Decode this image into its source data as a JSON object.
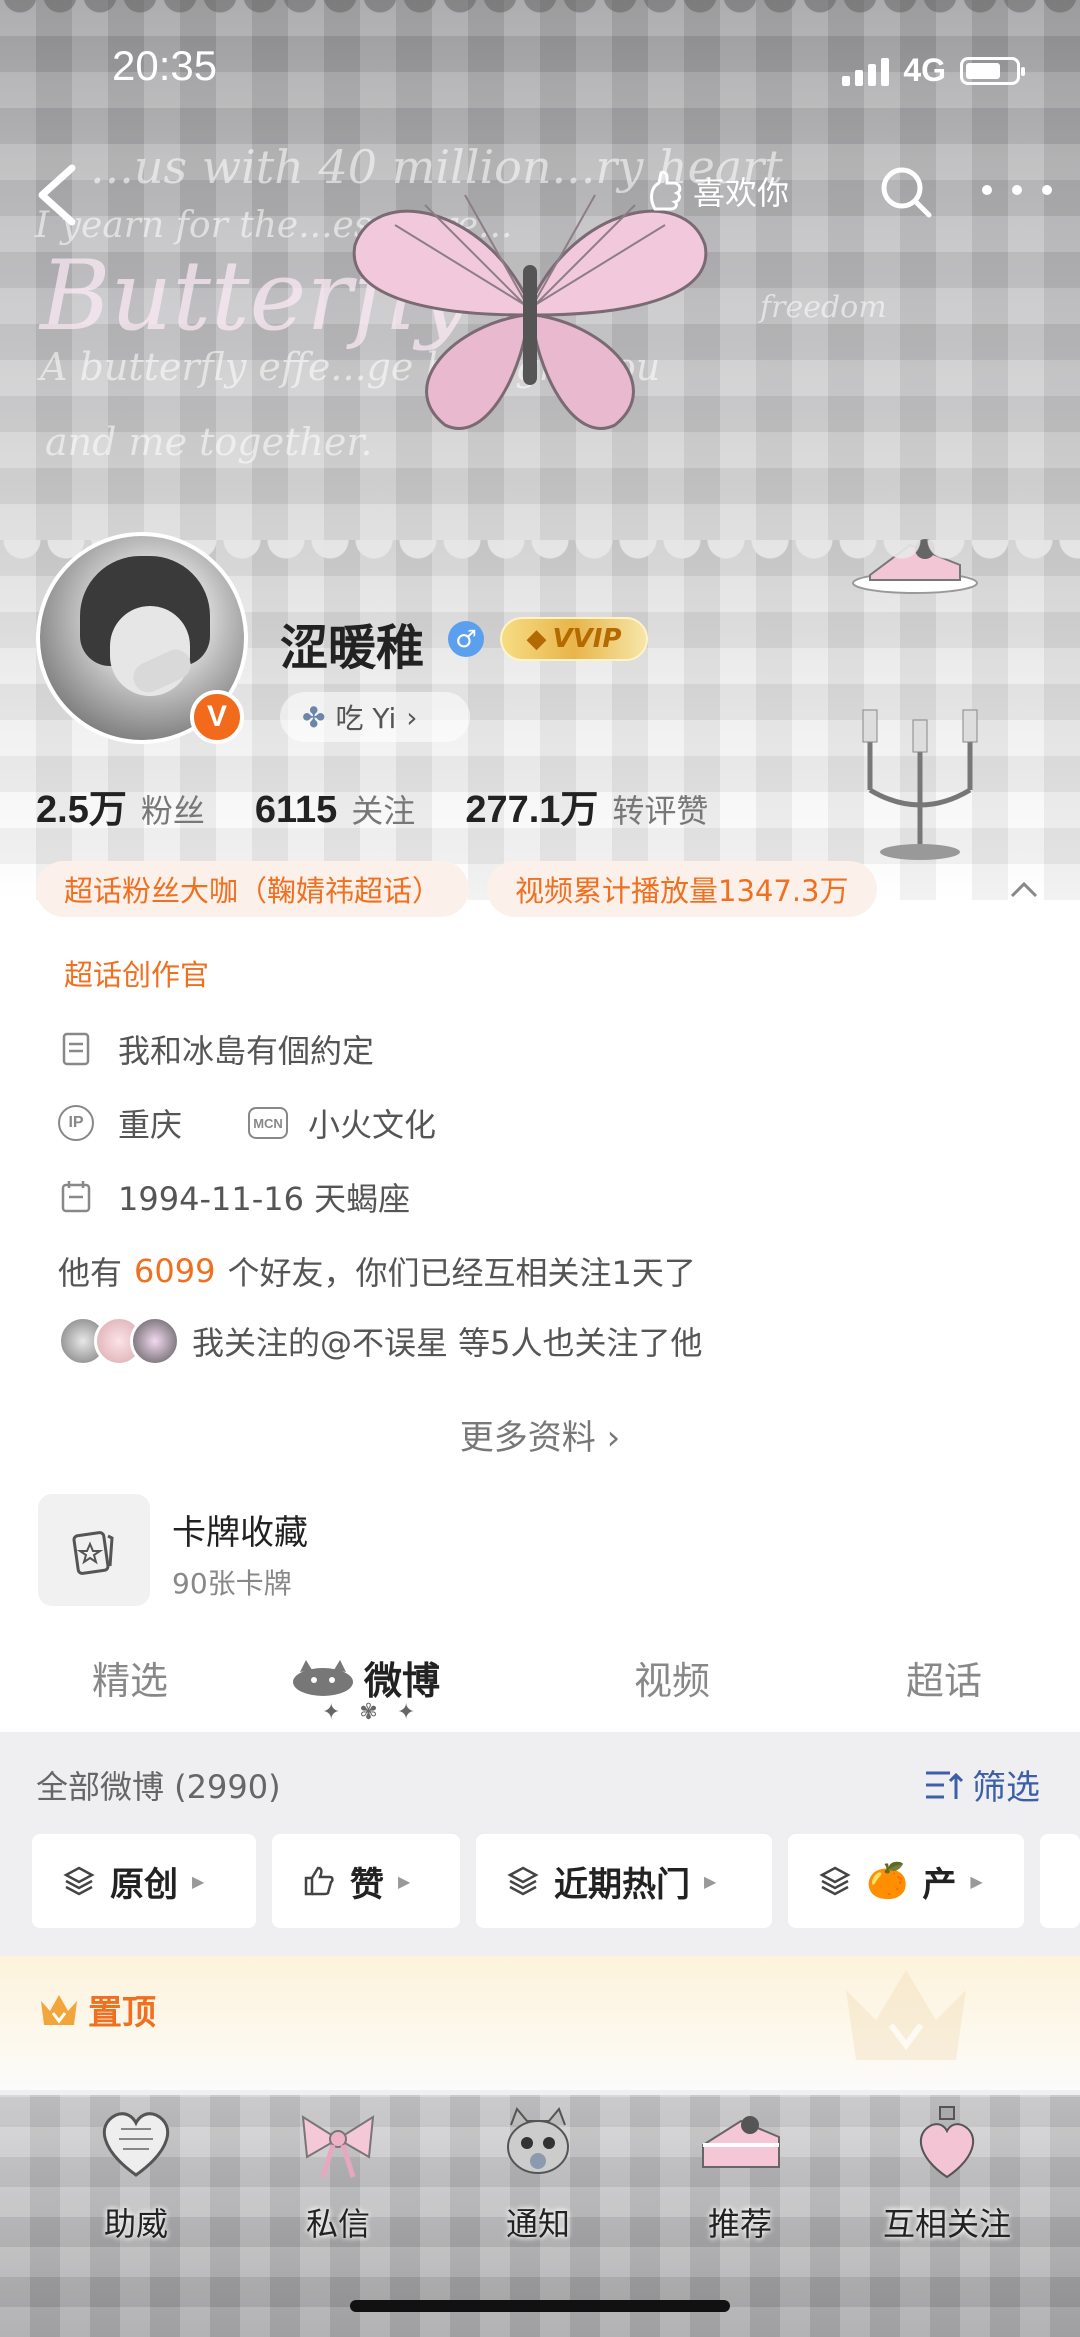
{
  "status_bar": {
    "time": "20:35",
    "network": "4G"
  },
  "banner": {
    "script_lines": [
      "...us with 40 million...ry heart",
      "I yearn for the...es more...",
      "Butterfly",
      "A butterfly effe...ge brought you",
      "and me together.",
      "freedom"
    ]
  },
  "nav": {
    "like_label": "喜欢你"
  },
  "profile": {
    "username": "涩暖稚",
    "vip_label": "VVIP",
    "tag_label": "吃 Yi",
    "verified_badge": "V",
    "gender_symbol": "♂"
  },
  "stats": [
    {
      "value": "2.5万",
      "label": "粉丝"
    },
    {
      "value": "6115",
      "label": "关注"
    },
    {
      "value": "277.1万",
      "label": "转评赞"
    }
  ],
  "badges": [
    "超话粉丝大咖（鞠婧祎超话）",
    "视频累计播放量1347.3万",
    "超话创作官"
  ],
  "info": {
    "bio": "我和冰島有個約定",
    "ip_icon": "IP",
    "location": "重庆",
    "mcn_icon": "MCN",
    "mcn": "小火文化",
    "birthday": "1994-11-16 天蝎座",
    "friends_prefix": "他有",
    "friends_count": "6099",
    "friends_suffix": "个好友，你们已经互相关注1天了",
    "mutual_text": "我关注的@不误星 等5人也关注了他"
  },
  "more_info_label": "更多资料 ›",
  "card_collection": {
    "title": "卡牌收藏",
    "subtitle": "90张卡牌"
  },
  "tabs": [
    "精选",
    "微博",
    "视频",
    "超话"
  ],
  "tab_decoration": "✦ ✾ ✦",
  "feed": {
    "header": "全部微博 (2990)",
    "filter_label": "筛选",
    "chips": [
      {
        "icon": "layers-icon",
        "label": "原创"
      },
      {
        "icon": "thumbs-up-icon",
        "label": "赞"
      },
      {
        "icon": "layers-icon",
        "label": "近期热门"
      },
      {
        "icon": "layers-icon",
        "emoji": "🍊",
        "label": "产"
      }
    ],
    "pinned_label": "置顶"
  },
  "bottom_bar": [
    "助威",
    "私信",
    "通知",
    "推荐",
    "互相关注"
  ],
  "colors": {
    "accent_orange": "#f07020",
    "filter_blue": "#3d5fa8",
    "verified_orange": "#f26a1b"
  }
}
